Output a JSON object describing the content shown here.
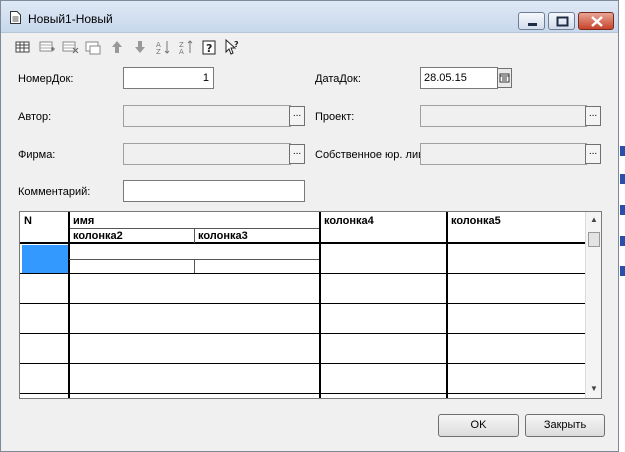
{
  "window": {
    "title": "Новый1-Новый",
    "controls": {
      "minimize": "minimize-icon",
      "maximize": "maximize-icon",
      "close": "close-icon"
    }
  },
  "toolbar": {
    "icons": [
      "table-icon",
      "add-row-icon",
      "delete-row-icon",
      "copy-row-icon",
      "move-up-icon",
      "move-down-icon",
      "sort-asc-icon",
      "sort-desc-icon",
      "help-icon",
      "pointer-help-icon"
    ]
  },
  "form": {
    "nomer_label": "НомерДок:",
    "nomer_value": "1",
    "data_label": "ДатаДок:",
    "data_value": "28.05.15",
    "avtor_label": "Автор:",
    "avtor_value": "",
    "proekt_label": "Проект:",
    "proekt_value": "",
    "firma_label": "Фирма:",
    "firma_value": "",
    "sobst_label": "Собственное юр. лиц",
    "sobst_value": "",
    "komment_label": "Комментарий:",
    "komment_value": "",
    "ellipsis": "..."
  },
  "table": {
    "headers": {
      "n": "N",
      "imya": "имя",
      "kolonka2": "колонка2",
      "kolonka3": "колонка3",
      "kolonka4": "колонка4",
      "kolonka5": "колонка5"
    }
  },
  "buttons": {
    "ok": "OK",
    "close": "Закрыть"
  },
  "colors": {
    "selection": "#3399ff",
    "title_bg": "#dfe9f5",
    "close_btn": "#c7452c"
  }
}
